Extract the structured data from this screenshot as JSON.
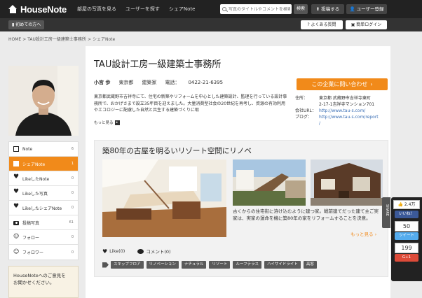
{
  "header": {
    "logo": "HouseNote",
    "nav": [
      "部屋の写真を見る",
      "ユーザーを探す",
      "シェアNote"
    ],
    "search_placeholder": "写真のタイトルやコメントを検索",
    "search_button": "検索",
    "post_button": "投稿する",
    "register_button": "ユーザー登録"
  },
  "subbar": {
    "first_time": "初めての方へ",
    "faq": "よくある質問",
    "login": "簡単ログイン"
  },
  "breadcrumb": [
    "HOME",
    "TAU設計工房一級建築士事務所",
    "シェアNote"
  ],
  "profile": {
    "company": "TAU設計工房一級建築士事務所",
    "name": "小宮 歩",
    "location": "東京都",
    "occupation": "建築家",
    "phone_label": "電話：",
    "phone": "0422-21-6395",
    "description": "東京都武蔵野市吉祥寺にて、住宅の新築やリフォームを中心とした建築設計、監理を行っている設計事務所で、おかげさまで設立35年目を迎えました。大量消費型社会の20世紀を再考し、資源の有効利用やエコロジーに配慮した自然と共生する建築づくりに取",
    "more": "もっと見る",
    "contact_button": "この企業に問い合わせ",
    "address_label": "住所：",
    "address_line1": "東京都 武蔵野市吉祥寺東町",
    "address_line2": "2-17-1吉祥寺マンション701",
    "url_label": "会社URL：",
    "url": "http://www.tau-s.com/",
    "blog_label": "ブログ：",
    "blog_url_1": "http://www.tau-s.com/report",
    "blog_url_2": "/"
  },
  "sidebar": {
    "items": [
      {
        "label": "Note",
        "count": "6"
      },
      {
        "label": "シェアNote",
        "count": "1"
      },
      {
        "label": "LikeしたNote",
        "count": "0"
      },
      {
        "label": "Likeした写真",
        "count": "0"
      },
      {
        "label": "LikeしたシェアNote",
        "count": "0"
      },
      {
        "label": "投稿写真",
        "count": "61"
      },
      {
        "label": "フォロー",
        "count": "0"
      },
      {
        "label": "フォロワー",
        "count": "0"
      }
    ],
    "box_text_1": "HouseNoteへのご意見を",
    "box_text_2": "お聞かせください。"
  },
  "article": {
    "title": "築80年の古屋を明るいリゾート空間にリノベ",
    "caption": "古くからの住宅街に溶け込むように建つ家。戦前建てだった建て主ご実家は、実家の運命を機に築80年の家をリフォームすることを決意。",
    "more": "もっと見る",
    "like": "Like(0)",
    "comment": "コメント(0)",
    "tags": [
      "スキップフロア",
      "リノベーション",
      "ナチュラル",
      "リゾート",
      "ルーフテラス",
      "ハイサイドライト",
      "高窓"
    ]
  },
  "share": {
    "tab": "SHARE",
    "fb_count": "2.4万",
    "fb_like": "いいね！",
    "tw_count": "50",
    "tw_label": "ツイート",
    "g_count": "199",
    "g_label": "G+1"
  },
  "colors": {
    "accent": "#f18a1a",
    "header": "#222222",
    "link": "#3b6fb5"
  }
}
